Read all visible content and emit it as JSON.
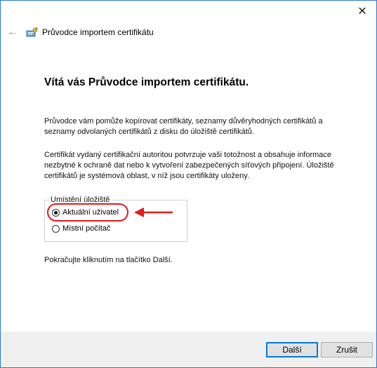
{
  "window": {
    "close_glyph": "✕",
    "back_glyph": "←",
    "title": "Průvodce importem certifikátu"
  },
  "content": {
    "heading": "Vítá vás Průvodce importem certifikátu.",
    "paragraph1": "Průvodce vám pomůže kopírovat certifikáty, seznamy důvěryhodných certifikátů a seznamy odvolaných certifikátů z disku do úložiště certifikátů.",
    "paragraph2": "Certifikát vydaný certifikační autoritou potvrzuje vaši totožnost a obsahuje informace nezbytné k ochraně dat nebo k vytvoření zabezpečených síťových připojení. Úložiště certifikátů je systémová oblast, v níž jsou certifikáty uloženy.",
    "store_group": {
      "legend": "Umístění úložiště",
      "options": [
        {
          "label": "Aktuální uživatel",
          "selected": true
        },
        {
          "label": "Místní počítač",
          "selected": false
        }
      ]
    },
    "paragraph3": "Pokračujte kliknutím na tlačítko Další."
  },
  "footer": {
    "next_label": "Další",
    "cancel_label": "Zrušit"
  },
  "colors": {
    "annotation": "#e01b1b",
    "focus": "#0078d7"
  },
  "icons": [
    "close-icon",
    "back-arrow-icon",
    "certificate-wizard-icon",
    "annotation-arrow-icon"
  ]
}
